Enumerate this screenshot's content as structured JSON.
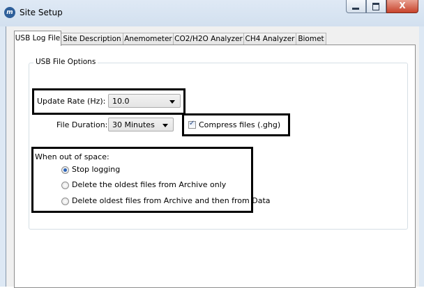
{
  "window": {
    "title": "Site Setup",
    "app_icon_glyph": "m",
    "min_icon": "minimize-icon",
    "max_icon": "maximize-icon",
    "close_glyph": "X"
  },
  "tabs": [
    {
      "label": "USB Log File",
      "active": true
    },
    {
      "label": "Site Description",
      "active": false
    },
    {
      "label": "Anemometer",
      "active": false
    },
    {
      "label": "CO2/H2O Analyzer",
      "active": false
    },
    {
      "label": "CH4 Analyzer",
      "active": false
    },
    {
      "label": "Biomet",
      "active": false
    }
  ],
  "usb_file_options": {
    "group_label": "USB File Options",
    "update_rate": {
      "label": "Update Rate (Hz):",
      "value": "10.0"
    },
    "file_duration": {
      "label": "File Duration:",
      "value": "30 Minutes"
    },
    "compress": {
      "label": "Compress files (.ghg)",
      "checked": true
    },
    "out_of_space": {
      "label": "When out of space:",
      "options": [
        {
          "label": "Stop logging",
          "selected": true
        },
        {
          "label": "Delete the oldest files from Archive only",
          "selected": false
        },
        {
          "label": "Delete oldest files from Archive and then from Data",
          "selected": false
        }
      ]
    }
  },
  "colors": {
    "accent": "#2a63b8",
    "highlight": "#000000"
  }
}
